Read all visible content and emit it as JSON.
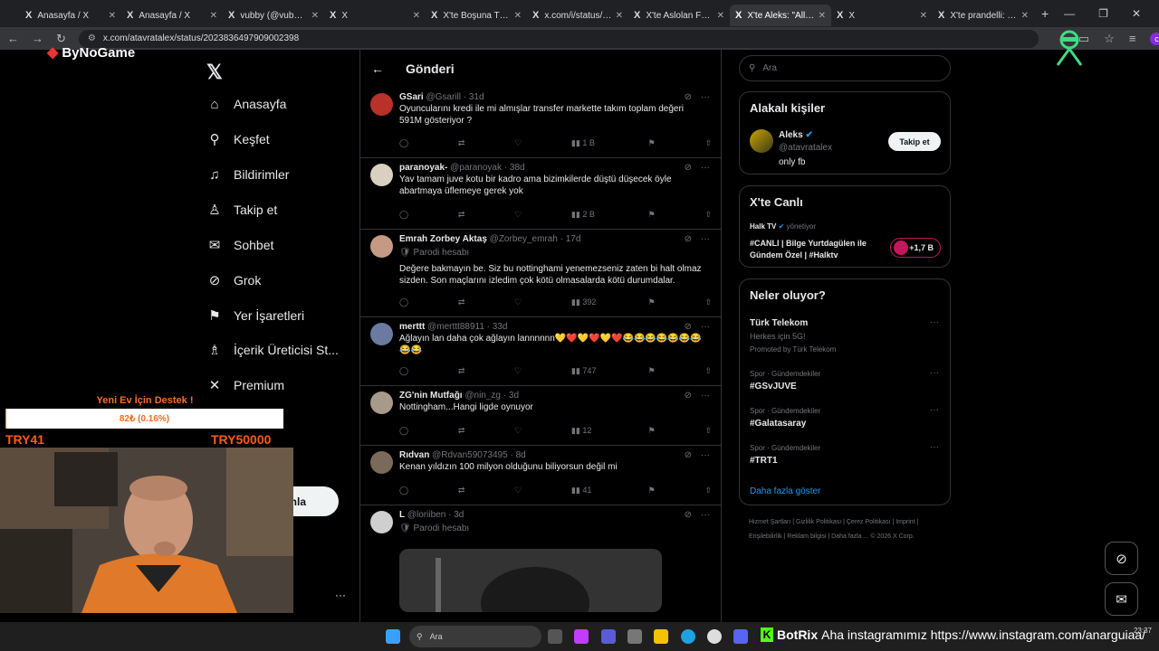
{
  "browser": {
    "tabs": [
      {
        "label": "Anasayfa / X"
      },
      {
        "label": "Anasayfa / X"
      },
      {
        "label": "vubby (@vubbyc"
      },
      {
        "label": "X"
      },
      {
        "label": "X'te Boşuna Tıklar"
      },
      {
        "label": "x.com/i/status/20"
      },
      {
        "label": "X'te Aslolan Fene"
      },
      {
        "label": "X'te Aleks: \"Allahı"
      },
      {
        "label": "X"
      },
      {
        "label": "X'te prandelli: \"sı"
      }
    ],
    "url": "x.com/atavratalex/status/2023836497909002398"
  },
  "nav": {
    "items": [
      {
        "label": "Anasayfa",
        "icon": "home-icon",
        "glyph": "⌂"
      },
      {
        "label": "Keşfet",
        "icon": "search-icon",
        "glyph": "⚲"
      },
      {
        "label": "Bildirimler",
        "icon": "bell-icon",
        "glyph": "♫"
      },
      {
        "label": "Takip et",
        "icon": "follow-icon",
        "glyph": "♙"
      },
      {
        "label": "Sohbet",
        "icon": "mail-icon",
        "glyph": "✉"
      },
      {
        "label": "Grok",
        "icon": "grok-icon",
        "glyph": "⊘"
      },
      {
        "label": "Yer İşaretleri",
        "icon": "bookmark-icon",
        "glyph": "⚑"
      },
      {
        "label": "İçerik Üreticisi St...",
        "icon": "creator-icon",
        "glyph": "♗"
      },
      {
        "label": "Premium",
        "icon": "x-icon",
        "glyph": "✕"
      }
    ],
    "post_button": "nla"
  },
  "center": {
    "title": "Gönderi",
    "tweets": [
      {
        "name": "GSari",
        "handle": "@Gsarill",
        "time": "31d",
        "text": "Oyuncularını kredi ile mi almışlar transfer markette takım toplam değeri 591M gösteriyor ?",
        "views": "1 B",
        "parody": ""
      },
      {
        "name": "paranoyak-",
        "handle": "@paranoyak",
        "time": "38d",
        "text": "Yav tamam juve kotu bir kadro ama bizimkilerde düştü düşecek öyle abartmaya üflemeye gerek yok",
        "views": "2 B",
        "parody": ""
      },
      {
        "name": "Emrah Zorbey Aktaş",
        "handle": "@Zorbey_emrah",
        "time": "17d",
        "text": "Değere bakmayın be. Siz bu nottinghami yenemezseniz zaten bi halt olmaz sizden. Son maçlarını izledim çok kötü olmasalarda kötü durumdalar.",
        "views": "392",
        "parody": "Parodi hesabı"
      },
      {
        "name": "merttt",
        "handle": "@merttt88911",
        "time": "33d",
        "text": "Ağlayın lan daha çok ağlayın lannnnnn💛❤️💛❤️💛❤️😂😂😂😂😂😂😂😂😂",
        "views": "747",
        "parody": ""
      },
      {
        "name": "ZG'nin Mutfağı",
        "handle": "@nin_zg",
        "time": "3d",
        "text": "Nottingham...Hangi ligde oynuyor",
        "views": "12",
        "parody": ""
      },
      {
        "name": "Rıdvan",
        "handle": "@Rdvan59073495",
        "time": "8d",
        "text": "Kenan yıldızın 100 milyon olduğunu biliyorsun değil mi",
        "views": "41",
        "parody": ""
      },
      {
        "name": "L",
        "handle": "@loriiben",
        "time": "3d",
        "text": "",
        "views": "",
        "parody": "Parodi hesabı"
      }
    ]
  },
  "right": {
    "search_placeholder": "Ara",
    "related": {
      "title": "Alakalı kişiler",
      "name": "Aleks",
      "handle": "@atavratalex",
      "bio": "only fb",
      "follow": "Takip et"
    },
    "live": {
      "title": "X'te Canlı",
      "host": "Halk TV",
      "host_suffix": "yönetiyor",
      "headline": "#CANLI | Bilge Yurtdagülen ile Gündem Özel | #Halktv",
      "count": "+1,7 B"
    },
    "trends": {
      "title": "Neler oluyor?",
      "promo_name": "Türk Telekom",
      "promo_sub": "Herkes için 5G!",
      "promo_tag": "Promoted by Türk Telekom",
      "items": [
        {
          "meta": "Spor · Gündemdekiler",
          "name": "#GSvJUVE"
        },
        {
          "meta": "Spor · Gündemdekiler",
          "name": "#Galatasaray"
        },
        {
          "meta": "Spor · Gündemdekiler",
          "name": "#TRT1"
        }
      ],
      "more": "Daha fazla göster"
    },
    "footer": "Hizmet Şartları | Gizlilik Politikası | Çerez Politikası | Imprint | Erişilebilirlik | Reklam bilgisi | Daha fazla ... © 2026 X Corp."
  },
  "overlay": {
    "logo": "ByNoGame",
    "donate_title": "Yeni Ev İçin Destek !",
    "donate_progress": "82₺ (0.16%)",
    "donate_fraction": 0.0016,
    "min": "TRY41",
    "max": "TRY50000"
  },
  "taskbar": {
    "search": "Ara",
    "botrix_name": "BotRix",
    "botrix_msg": "Aha instagramımız https://www.instagram.com/anarguiaa/",
    "time": "23:37"
  },
  "colors": {
    "accent": "#1d9bf0",
    "donate": "#ff5a1a",
    "kick": "#53fc18"
  }
}
